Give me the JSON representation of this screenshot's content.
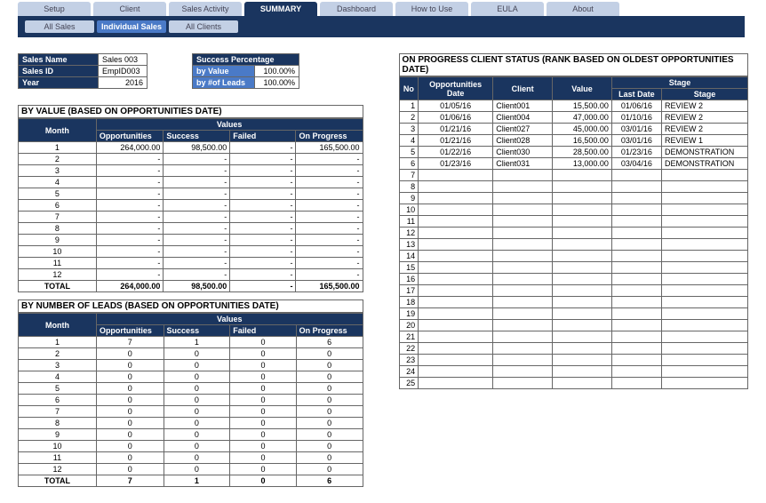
{
  "tabs": [
    "Setup",
    "Client",
    "Sales Activity",
    "SUMMARY",
    "Dashboard",
    "How to Use",
    "EULA",
    "About"
  ],
  "active_tab": 3,
  "sub_tabs": [
    "All Sales",
    "Individual Sales",
    "All Clients"
  ],
  "active_sub": 1,
  "info": {
    "sales_name_label": "Sales Name",
    "sales_name_value": "Sales 003",
    "sales_id_label": "Sales ID",
    "sales_id_value": "EmpID003",
    "year_label": "Year",
    "year_value": "2016",
    "success_pct_label": "Success Percentage",
    "by_value_label": "by Value",
    "by_value_value": "100.00%",
    "by_leads_label": "by #of Leads",
    "by_leads_value": "100.00%"
  },
  "by_value": {
    "title": "BY VALUE (BASED ON OPPORTUNITIES DATE)",
    "headers": {
      "month": "Month",
      "values": "Values",
      "opp": "Opportunities",
      "suc": "Success",
      "fail": "Failed",
      "prog": "On Progress"
    },
    "rows": [
      {
        "m": "1",
        "o": "264,000.00",
        "s": "98,500.00",
        "f": "-",
        "p": "165,500.00"
      },
      {
        "m": "2",
        "o": "-",
        "s": "-",
        "f": "-",
        "p": "-"
      },
      {
        "m": "3",
        "o": "-",
        "s": "-",
        "f": "-",
        "p": "-"
      },
      {
        "m": "4",
        "o": "-",
        "s": "-",
        "f": "-",
        "p": "-"
      },
      {
        "m": "5",
        "o": "-",
        "s": "-",
        "f": "-",
        "p": "-"
      },
      {
        "m": "6",
        "o": "-",
        "s": "-",
        "f": "-",
        "p": "-"
      },
      {
        "m": "7",
        "o": "-",
        "s": "-",
        "f": "-",
        "p": "-"
      },
      {
        "m": "8",
        "o": "-",
        "s": "-",
        "f": "-",
        "p": "-"
      },
      {
        "m": "9",
        "o": "-",
        "s": "-",
        "f": "-",
        "p": "-"
      },
      {
        "m": "10",
        "o": "-",
        "s": "-",
        "f": "-",
        "p": "-"
      },
      {
        "m": "11",
        "o": "-",
        "s": "-",
        "f": "-",
        "p": "-"
      },
      {
        "m": "12",
        "o": "-",
        "s": "-",
        "f": "-",
        "p": "-"
      }
    ],
    "total": {
      "label": "TOTAL",
      "o": "264,000.00",
      "s": "98,500.00",
      "f": "-",
      "p": "165,500.00"
    }
  },
  "by_leads": {
    "title": "BY NUMBER OF LEADS (BASED ON OPPORTUNITIES DATE)",
    "headers": {
      "month": "Month",
      "values": "Values",
      "opp": "Opportunities",
      "suc": "Success",
      "fail": "Failed",
      "prog": "On Progress"
    },
    "rows": [
      {
        "m": "1",
        "o": "7",
        "s": "1",
        "f": "0",
        "p": "6"
      },
      {
        "m": "2",
        "o": "0",
        "s": "0",
        "f": "0",
        "p": "0"
      },
      {
        "m": "3",
        "o": "0",
        "s": "0",
        "f": "0",
        "p": "0"
      },
      {
        "m": "4",
        "o": "0",
        "s": "0",
        "f": "0",
        "p": "0"
      },
      {
        "m": "5",
        "o": "0",
        "s": "0",
        "f": "0",
        "p": "0"
      },
      {
        "m": "6",
        "o": "0",
        "s": "0",
        "f": "0",
        "p": "0"
      },
      {
        "m": "7",
        "o": "0",
        "s": "0",
        "f": "0",
        "p": "0"
      },
      {
        "m": "8",
        "o": "0",
        "s": "0",
        "f": "0",
        "p": "0"
      },
      {
        "m": "9",
        "o": "0",
        "s": "0",
        "f": "0",
        "p": "0"
      },
      {
        "m": "10",
        "o": "0",
        "s": "0",
        "f": "0",
        "p": "0"
      },
      {
        "m": "11",
        "o": "0",
        "s": "0",
        "f": "0",
        "p": "0"
      },
      {
        "m": "12",
        "o": "0",
        "s": "0",
        "f": "0",
        "p": "0"
      }
    ],
    "total": {
      "label": "TOTAL",
      "o": "7",
      "s": "1",
      "f": "0",
      "p": "6"
    }
  },
  "progress": {
    "title": "ON PROGRESS CLIENT STATUS (RANK BASED ON OLDEST OPPORTUNITIES DATE)",
    "headers": {
      "no": "No",
      "date": "Opportunities Date",
      "client": "Client",
      "value": "Value",
      "stage": "Stage",
      "last": "Last Date",
      "stg": "Stage"
    },
    "rows": [
      {
        "n": "1",
        "d": "01/05/16",
        "c": "Client001",
        "v": "15,500.00",
        "ld": "01/06/16",
        "st": "REVIEW 2"
      },
      {
        "n": "2",
        "d": "01/06/16",
        "c": "Client004",
        "v": "47,000.00",
        "ld": "01/10/16",
        "st": "REVIEW 2"
      },
      {
        "n": "3",
        "d": "01/21/16",
        "c": "Client027",
        "v": "45,000.00",
        "ld": "03/01/16",
        "st": "REVIEW 2"
      },
      {
        "n": "4",
        "d": "01/21/16",
        "c": "Client028",
        "v": "16,500.00",
        "ld": "03/01/16",
        "st": "REVIEW 1"
      },
      {
        "n": "5",
        "d": "01/22/16",
        "c": "Client030",
        "v": "28,500.00",
        "ld": "01/23/16",
        "st": "DEMONSTRATION"
      },
      {
        "n": "6",
        "d": "01/23/16",
        "c": "Client031",
        "v": "13,000.00",
        "ld": "03/04/16",
        "st": "DEMONSTRATION"
      },
      {
        "n": "7",
        "d": "",
        "c": "",
        "v": "",
        "ld": "",
        "st": ""
      },
      {
        "n": "8",
        "d": "",
        "c": "",
        "v": "",
        "ld": "",
        "st": ""
      },
      {
        "n": "9",
        "d": "",
        "c": "",
        "v": "",
        "ld": "",
        "st": ""
      },
      {
        "n": "10",
        "d": "",
        "c": "",
        "v": "",
        "ld": "",
        "st": ""
      },
      {
        "n": "11",
        "d": "",
        "c": "",
        "v": "",
        "ld": "",
        "st": ""
      },
      {
        "n": "12",
        "d": "",
        "c": "",
        "v": "",
        "ld": "",
        "st": ""
      },
      {
        "n": "13",
        "d": "",
        "c": "",
        "v": "",
        "ld": "",
        "st": ""
      },
      {
        "n": "14",
        "d": "",
        "c": "",
        "v": "",
        "ld": "",
        "st": ""
      },
      {
        "n": "15",
        "d": "",
        "c": "",
        "v": "",
        "ld": "",
        "st": ""
      },
      {
        "n": "16",
        "d": "",
        "c": "",
        "v": "",
        "ld": "",
        "st": ""
      },
      {
        "n": "17",
        "d": "",
        "c": "",
        "v": "",
        "ld": "",
        "st": ""
      },
      {
        "n": "18",
        "d": "",
        "c": "",
        "v": "",
        "ld": "",
        "st": ""
      },
      {
        "n": "19",
        "d": "",
        "c": "",
        "v": "",
        "ld": "",
        "st": ""
      },
      {
        "n": "20",
        "d": "",
        "c": "",
        "v": "",
        "ld": "",
        "st": ""
      },
      {
        "n": "21",
        "d": "",
        "c": "",
        "v": "",
        "ld": "",
        "st": ""
      },
      {
        "n": "22",
        "d": "",
        "c": "",
        "v": "",
        "ld": "",
        "st": ""
      },
      {
        "n": "23",
        "d": "",
        "c": "",
        "v": "",
        "ld": "",
        "st": ""
      },
      {
        "n": "24",
        "d": "",
        "c": "",
        "v": "",
        "ld": "",
        "st": ""
      },
      {
        "n": "25",
        "d": "",
        "c": "",
        "v": "",
        "ld": "",
        "st": ""
      }
    ]
  },
  "chart_data": [
    {
      "type": "table",
      "title": "By Value (Based on Opportunities Date)",
      "categories": [
        "1",
        "2",
        "3",
        "4",
        "5",
        "6",
        "7",
        "8",
        "9",
        "10",
        "11",
        "12"
      ],
      "series": [
        {
          "name": "Opportunities",
          "values": [
            264000,
            0,
            0,
            0,
            0,
            0,
            0,
            0,
            0,
            0,
            0,
            0
          ]
        },
        {
          "name": "Success",
          "values": [
            98500,
            0,
            0,
            0,
            0,
            0,
            0,
            0,
            0,
            0,
            0,
            0
          ]
        },
        {
          "name": "Failed",
          "values": [
            0,
            0,
            0,
            0,
            0,
            0,
            0,
            0,
            0,
            0,
            0,
            0
          ]
        },
        {
          "name": "On Progress",
          "values": [
            165500,
            0,
            0,
            0,
            0,
            0,
            0,
            0,
            0,
            0,
            0,
            0
          ]
        }
      ],
      "totals": {
        "Opportunities": 264000,
        "Success": 98500,
        "Failed": 0,
        "On Progress": 165500
      }
    },
    {
      "type": "table",
      "title": "By Number of Leads (Based on Opportunities Date)",
      "categories": [
        "1",
        "2",
        "3",
        "4",
        "5",
        "6",
        "7",
        "8",
        "9",
        "10",
        "11",
        "12"
      ],
      "series": [
        {
          "name": "Opportunities",
          "values": [
            7,
            0,
            0,
            0,
            0,
            0,
            0,
            0,
            0,
            0,
            0,
            0
          ]
        },
        {
          "name": "Success",
          "values": [
            1,
            0,
            0,
            0,
            0,
            0,
            0,
            0,
            0,
            0,
            0,
            0
          ]
        },
        {
          "name": "Failed",
          "values": [
            0,
            0,
            0,
            0,
            0,
            0,
            0,
            0,
            0,
            0,
            0,
            0
          ]
        },
        {
          "name": "On Progress",
          "values": [
            6,
            0,
            0,
            0,
            0,
            0,
            0,
            0,
            0,
            0,
            0,
            0
          ]
        }
      ],
      "totals": {
        "Opportunities": 7,
        "Success": 1,
        "Failed": 0,
        "On Progress": 6
      }
    }
  ]
}
